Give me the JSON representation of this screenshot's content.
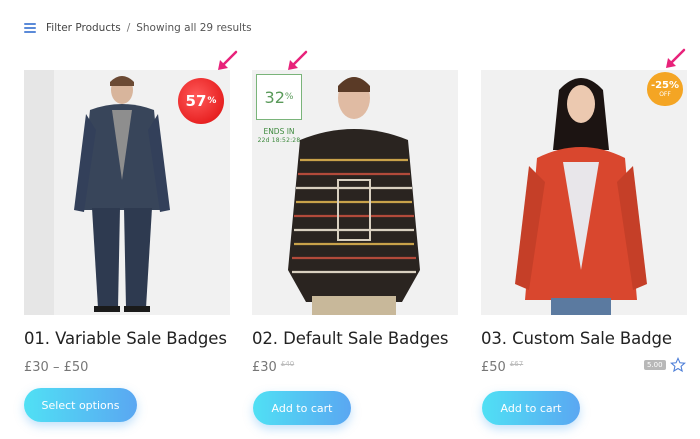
{
  "toolbar": {
    "filter_label": "Filter Products",
    "separator": "/",
    "result_count": "Showing all 29 results"
  },
  "products": [
    {
      "title": "01. Variable Sale Badges",
      "price": "£30 – £50",
      "old_price": "",
      "button": "Select options",
      "badge": {
        "value": "57",
        "unit": "%",
        "color": "#e82222"
      }
    },
    {
      "title": "02. Default Sale Badges",
      "price": "£30",
      "old_price": "£40",
      "button": "Add to cart",
      "badge": {
        "value": "32",
        "unit": "%",
        "color": "#5a9a5a"
      },
      "countdown": {
        "label": "ENDS IN",
        "time": "22d 18:52:28"
      }
    },
    {
      "title": "03. Custom Sale Badge",
      "price": "£50",
      "old_price": "£67",
      "button": "Add to cart",
      "badge": {
        "value": "-25%",
        "sub": "OFF",
        "color": "#f4a524"
      },
      "rating": "5.00"
    }
  ],
  "colors": {
    "accent_gradient_start": "#50e0f4",
    "accent_gradient_end": "#5aa7f2",
    "arrow": "#e8227a"
  }
}
